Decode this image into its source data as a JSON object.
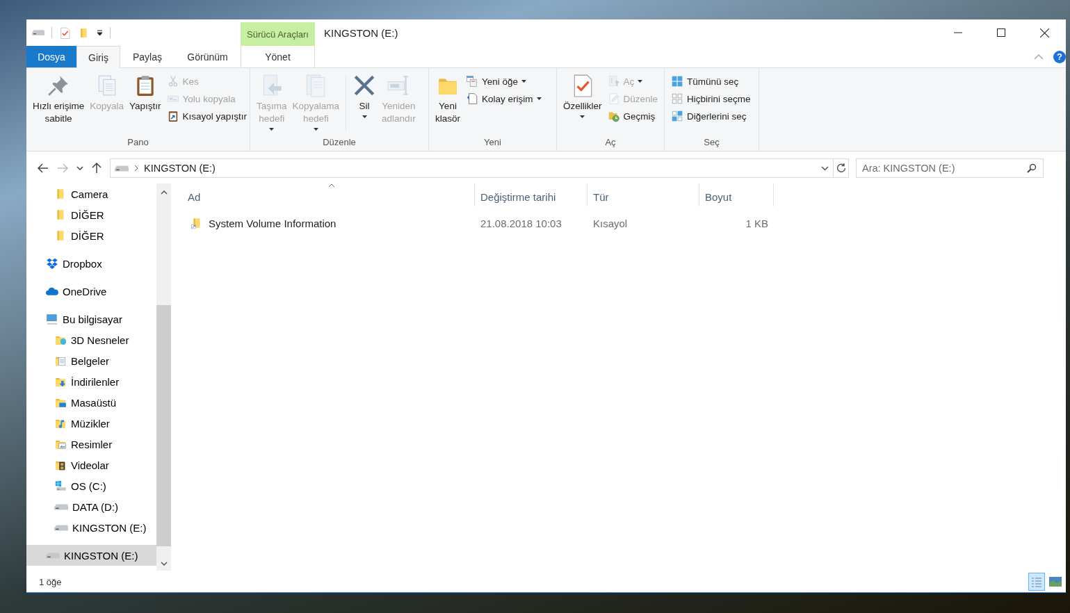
{
  "window": {
    "title": "KINGSTON (E:)"
  },
  "context_tab": {
    "label": "Sürücü Araçları"
  },
  "ribbon_tabs": [
    {
      "label": "Dosya",
      "kind": "file",
      "selected": false
    },
    {
      "label": "Giriş",
      "kind": "tab",
      "selected": true
    },
    {
      "label": "Paylaş",
      "kind": "tab",
      "selected": false
    },
    {
      "label": "Görünüm",
      "kind": "tab",
      "selected": false
    },
    {
      "label": "Yönet",
      "kind": "context",
      "selected": false
    }
  ],
  "help_button": {
    "label": "?"
  },
  "ribbon_groups": [
    {
      "label": "Pano",
      "items": [
        {
          "kind": "large",
          "label": "Hızlı erişime\nsabitle",
          "disabled": false,
          "has_menu": false
        },
        {
          "kind": "large",
          "label": "Kopyala",
          "disabled": true,
          "has_menu": false
        },
        {
          "kind": "large",
          "label": "Yapıştır",
          "disabled": false,
          "has_menu": false
        },
        {
          "kind": "small",
          "label": "Kes",
          "disabled": true,
          "has_menu": false
        },
        {
          "kind": "small",
          "label": "Yolu kopyala",
          "disabled": true,
          "has_menu": false
        },
        {
          "kind": "small",
          "label": "Kısayol yapıştır",
          "disabled": false,
          "has_menu": false
        }
      ]
    },
    {
      "label": "Düzenle",
      "items": [
        {
          "kind": "large",
          "label": "Taşıma\nhedefi",
          "disabled": true,
          "has_menu": true
        },
        {
          "kind": "large",
          "label": "Kopyalama\nhedefi",
          "disabled": true,
          "has_menu": true
        },
        {
          "kind": "separator"
        },
        {
          "kind": "large",
          "label": "Sil",
          "disabled": false,
          "has_menu": true
        },
        {
          "kind": "large",
          "label": "Yeniden\nadlandır",
          "disabled": true,
          "has_menu": false
        }
      ]
    },
    {
      "label": "Yeni",
      "items": [
        {
          "kind": "large",
          "label": "Yeni\nklasör",
          "disabled": false,
          "has_menu": false
        },
        {
          "kind": "small",
          "label": "Yeni öğe",
          "disabled": false,
          "has_menu": true
        },
        {
          "kind": "small",
          "label": "Kolay erişim",
          "disabled": false,
          "has_menu": true
        }
      ]
    },
    {
      "label": "Aç",
      "items": [
        {
          "kind": "large",
          "label": "Özellikler",
          "disabled": false,
          "has_menu": true
        },
        {
          "kind": "small",
          "label": "Aç",
          "disabled": true,
          "has_menu": true
        },
        {
          "kind": "small",
          "label": "Düzenle",
          "disabled": true,
          "has_menu": false
        },
        {
          "kind": "small",
          "label": "Geçmiş",
          "disabled": false,
          "has_menu": false
        }
      ]
    },
    {
      "label": "Seç",
      "items": [
        {
          "kind": "small",
          "label": "Tümünü seç",
          "disabled": false,
          "has_menu": false
        },
        {
          "kind": "small",
          "label": "Hiçbirini seçme",
          "disabled": false,
          "has_menu": false
        },
        {
          "kind": "small",
          "label": "Diğerlerini seç",
          "disabled": false,
          "has_menu": false
        }
      ]
    }
  ],
  "navigation": {
    "back_disabled": false,
    "forward_disabled": true
  },
  "address_bar": {
    "path": "KINGSTON (E:)"
  },
  "search": {
    "placeholder": "Ara: KINGSTON (E:)"
  },
  "nav_tree": [
    {
      "children": [
        {
          "label": "Camera",
          "kind": "folder",
          "selected": false
        },
        {
          "label": "DİĞER",
          "kind": "folder",
          "selected": false
        },
        {
          "label": "DİĞER",
          "kind": "folder",
          "selected": false
        }
      ]
    },
    {
      "label": "Dropbox",
      "kind": "dropbox",
      "selected": false
    },
    {
      "label": "OneDrive",
      "kind": "onedrive",
      "selected": false
    },
    {
      "label": "Bu bilgisayar",
      "kind": "pc",
      "selected": false,
      "children": [
        {
          "label": "3D Nesneler",
          "kind": "objects3d",
          "selected": false
        },
        {
          "label": "Belgeler",
          "kind": "documents",
          "selected": false
        },
        {
          "label": "İndirilenler",
          "kind": "downloads",
          "selected": false
        },
        {
          "label": "Masaüstü",
          "kind": "desktop",
          "selected": false
        },
        {
          "label": "Müzikler",
          "kind": "music",
          "selected": false
        },
        {
          "label": "Resimler",
          "kind": "pictures",
          "selected": false
        },
        {
          "label": "Videolar",
          "kind": "videos",
          "selected": false
        },
        {
          "label": "OS (C:)",
          "kind": "osdrive",
          "selected": false
        },
        {
          "label": "DATA (D:)",
          "kind": "drive",
          "selected": false
        },
        {
          "label": "KINGSTON (E:)",
          "kind": "drive",
          "selected": false
        }
      ]
    },
    {
      "label": "KINGSTON (E:)",
      "kind": "drive",
      "selected": true
    }
  ],
  "table": {
    "columns": [
      {
        "label": "Ad",
        "sorted": true
      },
      {
        "label": "Değiştirme tarihi",
        "sorted": false
      },
      {
        "label": "Tür",
        "sorted": false
      },
      {
        "label": "Boyut",
        "sorted": false
      }
    ],
    "rows": [
      {
        "cells": [
          "System Volume Information",
          "21.08.2018 10:03",
          "Kısayol",
          "1 KB"
        ],
        "selected": false
      }
    ]
  },
  "status_bar": {
    "item_count": "1 öğe"
  },
  "view_buttons": [
    {
      "kind": "details",
      "selected": true
    },
    {
      "kind": "large_icons",
      "selected": false
    }
  ]
}
